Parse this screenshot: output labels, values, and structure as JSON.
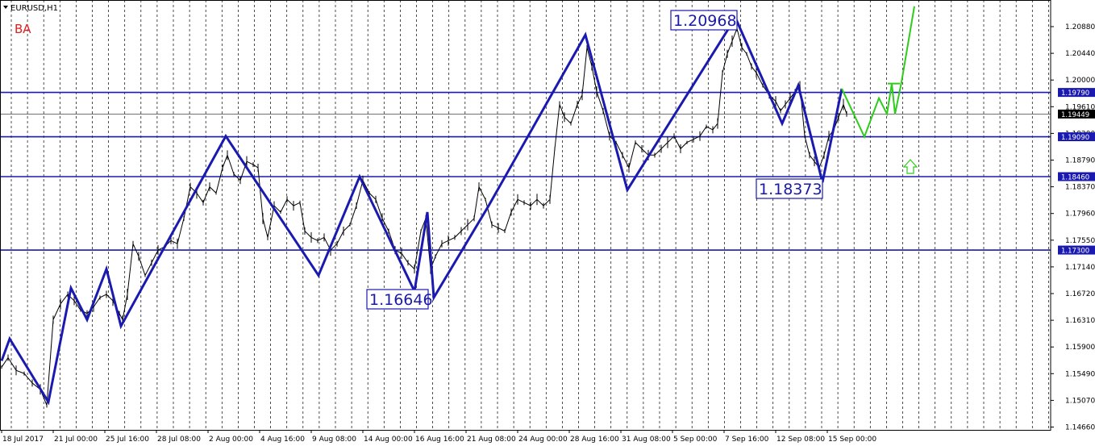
{
  "window": {
    "title": "EURUSD,H1",
    "indicator_label": "BA"
  },
  "chart_data": {
    "type": "line",
    "symbol": "EURUSD",
    "timeframe": "H1",
    "ylim": [
      1.1446,
      1.2125
    ],
    "xlim": [
      0,
      1303
    ],
    "x_tick_labels": [
      "18 Jul 2017",
      "21 Jul 00:00",
      "25 Jul 16:00",
      "28 Jul 08:00",
      "2 Aug 00:00",
      "4 Aug 16:00",
      "9 Aug 08:00",
      "14 Aug 00:00",
      "16 Aug 16:00",
      "21 Aug 08:00",
      "24 Aug 00:00",
      "28 Aug 16:00",
      "31 Aug 08:00",
      "5 Sep 00:00",
      "7 Sep 16:00",
      "12 Sep 08:00",
      "15 Sep 00:00"
    ],
    "y_tick_labels": [
      "1.20880",
      "1.20440",
      "1.20000",
      "1.19610",
      "1.19200",
      "1.18790",
      "1.18370",
      "1.17960",
      "1.17550",
      "1.17140",
      "1.16720",
      "1.16310",
      "1.15900",
      "1.15490",
      "1.15070",
      "1.14660"
    ],
    "grid": "vertical-dashed",
    "current_price": "1.19449",
    "horizontal_levels": [
      {
        "label": "1.19790",
        "value": 1.1979
      },
      {
        "label": "1.19090",
        "value": 1.1909
      },
      {
        "label": "1.18460",
        "value": 1.1846
      },
      {
        "label": "1.17300",
        "value": 1.173
      }
    ],
    "price_series": [
      [
        2,
        1.1545
      ],
      [
        10,
        1.156
      ],
      [
        20,
        1.154
      ],
      [
        30,
        1.1535
      ],
      [
        40,
        1.152
      ],
      [
        50,
        1.151
      ],
      [
        58,
        1.1485
      ],
      [
        66,
        1.162
      ],
      [
        75,
        1.1645
      ],
      [
        84,
        1.166
      ],
      [
        92,
        1.165
      ],
      [
        100,
        1.1635
      ],
      [
        108,
        1.163
      ],
      [
        116,
        1.164
      ],
      [
        124,
        1.1655
      ],
      [
        132,
        1.166
      ],
      [
        140,
        1.165
      ],
      [
        148,
        1.163
      ],
      [
        152,
        1.162
      ],
      [
        158,
        1.166
      ],
      [
        165,
        1.174
      ],
      [
        172,
        1.172
      ],
      [
        180,
        1.169
      ],
      [
        188,
        1.171
      ],
      [
        196,
        1.173
      ],
      [
        204,
        1.1735
      ],
      [
        212,
        1.1745
      ],
      [
        220,
        1.174
      ],
      [
        228,
        1.178
      ],
      [
        236,
        1.183
      ],
      [
        244,
        1.182
      ],
      [
        252,
        1.1805
      ],
      [
        260,
        1.183
      ],
      [
        268,
        1.182
      ],
      [
        276,
        1.186
      ],
      [
        282,
        1.188
      ],
      [
        290,
        1.185
      ],
      [
        298,
        1.184
      ],
      [
        306,
        1.187
      ],
      [
        314,
        1.1865
      ],
      [
        320,
        1.186
      ],
      [
        326,
        1.178
      ],
      [
        332,
        1.175
      ],
      [
        340,
        1.18
      ],
      [
        348,
        1.179
      ],
      [
        356,
        1.181
      ],
      [
        364,
        1.18
      ],
      [
        372,
        1.1805
      ],
      [
        378,
        1.176
      ],
      [
        386,
        1.175
      ],
      [
        394,
        1.1745
      ],
      [
        402,
        1.175
      ],
      [
        410,
        1.173
      ],
      [
        418,
        1.174
      ],
      [
        426,
        1.176
      ],
      [
        434,
        1.177
      ],
      [
        442,
        1.18
      ],
      [
        450,
        1.184
      ],
      [
        458,
        1.182
      ],
      [
        466,
        1.181
      ],
      [
        474,
        1.178
      ],
      [
        482,
        1.176
      ],
      [
        490,
        1.173
      ],
      [
        498,
        1.1725
      ],
      [
        506,
        1.171
      ],
      [
        514,
        1.17
      ],
      [
        522,
        1.176
      ],
      [
        528,
        1.178
      ],
      [
        534,
        1.17
      ],
      [
        540,
        1.172
      ],
      [
        548,
        1.174
      ],
      [
        556,
        1.1745
      ],
      [
        564,
        1.175
      ],
      [
        572,
        1.176
      ],
      [
        580,
        1.177
      ],
      [
        588,
        1.178
      ],
      [
        594,
        1.183
      ],
      [
        602,
        1.181
      ],
      [
        610,
        1.177
      ],
      [
        618,
        1.1765
      ],
      [
        626,
        1.176
      ],
      [
        634,
        1.179
      ],
      [
        642,
        1.181
      ],
      [
        650,
        1.1805
      ],
      [
        658,
        1.18
      ],
      [
        666,
        1.181
      ],
      [
        674,
        1.18
      ],
      [
        682,
        1.181
      ],
      [
        688,
        1.189
      ],
      [
        694,
        1.196
      ],
      [
        700,
        1.194
      ],
      [
        708,
        1.193
      ],
      [
        716,
        1.196
      ],
      [
        722,
        1.1975
      ],
      [
        728,
        1.205
      ],
      [
        734,
        1.202
      ],
      [
        740,
        1.198
      ],
      [
        748,
        1.195
      ],
      [
        756,
        1.191
      ],
      [
        764,
        1.19
      ],
      [
        772,
        1.188
      ],
      [
        780,
        1.186
      ],
      [
        788,
        1.19
      ],
      [
        796,
        1.189
      ],
      [
        804,
        1.188
      ],
      [
        812,
        1.188
      ],
      [
        820,
        1.189
      ],
      [
        828,
        1.19
      ],
      [
        836,
        1.191
      ],
      [
        844,
        1.189
      ],
      [
        852,
        1.19
      ],
      [
        860,
        1.1905
      ],
      [
        868,
        1.191
      ],
      [
        876,
        1.1925
      ],
      [
        884,
        1.192
      ],
      [
        890,
        1.193
      ],
      [
        896,
        1.201
      ],
      [
        902,
        1.204
      ],
      [
        908,
        1.206
      ],
      [
        914,
        1.208
      ],
      [
        920,
        1.205
      ],
      [
        926,
        1.204
      ],
      [
        932,
        1.202
      ],
      [
        938,
        1.201
      ],
      [
        946,
        1.199
      ],
      [
        954,
        1.1975
      ],
      [
        962,
        1.1965
      ],
      [
        968,
        1.195
      ],
      [
        974,
        1.196
      ],
      [
        980,
        1.197
      ],
      [
        986,
        1.198
      ],
      [
        992,
        1.199
      ],
      [
        998,
        1.191
      ],
      [
        1004,
        1.188
      ],
      [
        1010,
        1.187
      ],
      [
        1016,
        1.186
      ],
      [
        1022,
        1.188
      ],
      [
        1028,
        1.191
      ],
      [
        1034,
        1.192
      ],
      [
        1040,
        1.194
      ],
      [
        1046,
        1.196
      ],
      [
        1050,
        1.1945
      ]
    ],
    "wave_series": [
      [
        2,
        1.1555
      ],
      [
        12,
        1.159
      ],
      [
        60,
        1.149
      ],
      [
        88,
        1.167
      ],
      [
        108,
        1.162
      ],
      [
        132,
        1.17
      ],
      [
        150,
        1.161
      ],
      [
        280,
        1.191
      ],
      [
        395,
        1.169
      ],
      [
        446,
        1.1846
      ],
      [
        514,
        1.1665
      ],
      [
        530,
        1.179
      ],
      [
        538,
        1.1655
      ],
      [
        606,
        1.18
      ],
      [
        726,
        1.207
      ],
      [
        778,
        1.1825
      ],
      [
        912,
        1.2097
      ],
      [
        970,
        1.193
      ],
      [
        990,
        1.199
      ],
      [
        1020,
        1.1837
      ],
      [
        1044,
        1.1985
      ]
    ],
    "projection_series": [
      [
        1044,
        1.1985
      ],
      [
        1072,
        1.1909
      ],
      [
        1090,
        1.197
      ],
      [
        1100,
        1.1945
      ],
      [
        1106,
        1.1993
      ],
      [
        1110,
        1.1945
      ],
      [
        1118,
        1.1995
      ],
      [
        1134,
        1.2115
      ]
    ],
    "annotations": [
      {
        "label": "1.20968",
        "value": 1.20968,
        "x": 912
      },
      {
        "label": "1.18373",
        "value": 1.18373,
        "x": 1020
      },
      {
        "label": "1.16646",
        "value": 1.16646,
        "x": 514
      }
    ],
    "colors": {
      "price": "#000000",
      "wave": "#1a1ab0",
      "level": "#1a1ab0",
      "projection": "#2ecc1a",
      "up_arrow": "#2ecc1a",
      "current_price_badge": "#000000",
      "level_badge": "#1a1ab0"
    }
  }
}
